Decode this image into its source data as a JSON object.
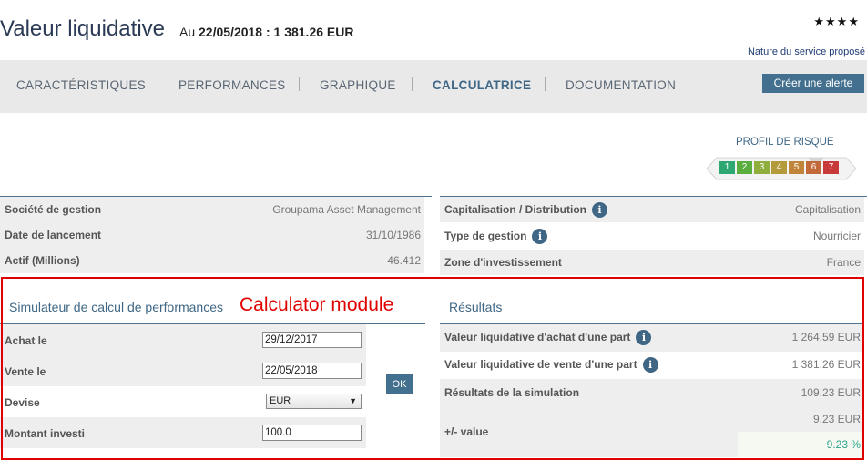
{
  "header": {
    "title": "Valeur liquidative",
    "date_prefix": "Au",
    "date_value": "22/05/2018 : 1 381.26 EUR",
    "stars": "★★★★",
    "service_link": "Nature du service proposé"
  },
  "tabs": [
    {
      "label": "CARACTÉRISTIQUES"
    },
    {
      "label": "PERFORMANCES"
    },
    {
      "label": "GRAPHIQUE"
    },
    {
      "label": "CALCULATRICE",
      "active": true
    },
    {
      "label": "DOCUMENTATION"
    }
  ],
  "alert_button": "Créer une alerte",
  "risk": {
    "title": "PROFIL DE RISQUE",
    "levels": [
      "1",
      "2",
      "3",
      "4",
      "5",
      "6",
      "7"
    ],
    "colors": [
      "#2ea872",
      "#5aae3e",
      "#8fae3e",
      "#b39a3b",
      "#c0843a",
      "#c36a3a",
      "#c83a3a"
    ],
    "selected": "6"
  },
  "info_left": [
    {
      "label": "Société de gestion",
      "value": "Groupama Asset Management"
    },
    {
      "label": "Date de lancement",
      "value": "31/10/1986"
    },
    {
      "label": "Actif (Millions)",
      "value": "46.412"
    }
  ],
  "info_right": [
    {
      "label": "Capitalisation / Distribution",
      "value": "Capitalisation"
    },
    {
      "label": "Type de gestion",
      "value": "Nourricier"
    },
    {
      "label": "Zone d'investissement",
      "value": "France"
    }
  ],
  "info_icon": "i",
  "simulator": {
    "title": "Simulateur de calcul de performances",
    "annotation": "Calculator module",
    "fields": [
      {
        "label": "Achat le",
        "value": "29/12/2017"
      },
      {
        "label": "Vente le",
        "value": "22/05/2018"
      },
      {
        "label": "Devise",
        "value": "EUR"
      },
      {
        "label": "Montant investi",
        "value": "100.0"
      }
    ],
    "ok_label": "OK"
  },
  "results": {
    "title": "Résultats",
    "rows": [
      {
        "label": "Valeur liquidative d'achat d'une part",
        "value": "1 264.59 EUR"
      },
      {
        "label": "Valeur liquidative de vente d'une part",
        "value": "1 381.26 EUR"
      },
      {
        "label": "Résultats de la simulation",
        "value": "109.23 EUR"
      },
      {
        "label": "+/- value",
        "value": "9.23 EUR",
        "pct": "9.23 %"
      }
    ]
  }
}
